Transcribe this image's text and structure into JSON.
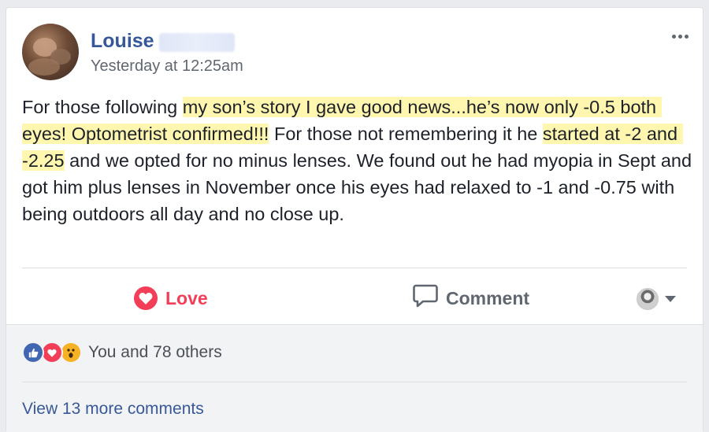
{
  "post": {
    "author": "Louise",
    "timestamp": "Yesterday at 12:25am",
    "text_segments": [
      {
        "text": "For those following ",
        "highlight": false
      },
      {
        "text": "my son’s story I gave good news...he’s now only -0.5 both eyes! Optometrist confirmed!!!",
        "highlight": true
      },
      {
        "text": " For those not remembering it he ",
        "highlight": false
      },
      {
        "text": "started at -2 and -2.25",
        "highlight": true
      },
      {
        "text": " and we opted for no minus lenses. We found out he had myopia in Sept and got him plus lenses in November once his eyes had relaxed to -1 and -0.75 with being outdoors all day and no close up.",
        "highlight": false
      }
    ]
  },
  "actions": {
    "love_label": "Love",
    "comment_label": "Comment"
  },
  "reactions": {
    "icons": [
      "like-icon",
      "love-icon",
      "wow-icon"
    ],
    "summary": "You and 78 others"
  },
  "comments": {
    "view_more_label": "View 13 more comments"
  },
  "colors": {
    "link_blue": "#365899",
    "love_red": "#f33e58",
    "highlight_yellow": "#fff7b0",
    "muted_text": "#606770"
  }
}
